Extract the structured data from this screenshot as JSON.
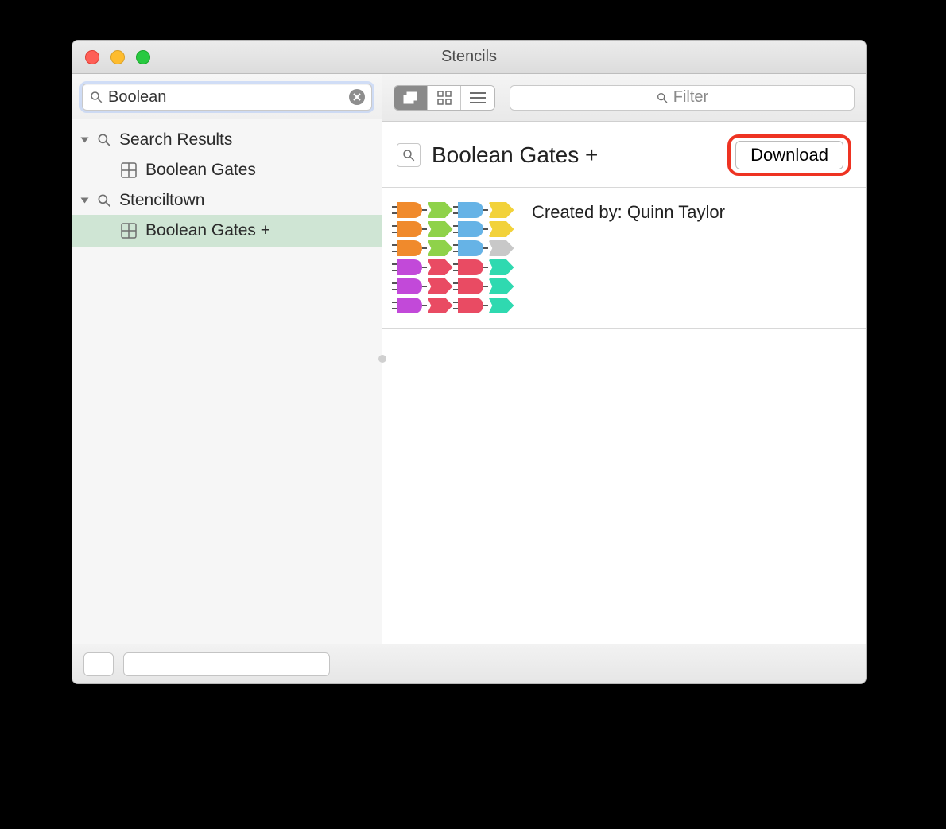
{
  "window": {
    "title": "Stencils"
  },
  "sidebar": {
    "search": {
      "value": "Boolean",
      "placeholder": ""
    },
    "groups": [
      {
        "label": "Search Results",
        "items": [
          {
            "label": "Boolean Gates",
            "selected": false
          }
        ]
      },
      {
        "label": "Stenciltown",
        "items": [
          {
            "label": "Boolean Gates +",
            "selected": true
          }
        ]
      }
    ]
  },
  "main": {
    "filter_placeholder": "Filter",
    "detail": {
      "title": "Boolean Gates +",
      "download_label": "Download",
      "meta": "Created by: Quinn Taylor",
      "thumb_rows": [
        [
          "#f08a2c",
          "#8fd24a",
          "#66b3e6",
          "#f2d23a"
        ],
        [
          "#f08a2c",
          "#8fd24a",
          "#66b3e6",
          "#f2d23a"
        ],
        [
          "#f08a2c",
          "#8fd24a",
          "#66b3e6",
          "#c8c8c8"
        ],
        [
          "#c249d9",
          "#e94b63",
          "#e94b63",
          "#2fd9b0"
        ],
        [
          "#c249d9",
          "#e94b63",
          "#e94b63",
          "#2fd9b0"
        ],
        [
          "#c249d9",
          "#e94b63",
          "#e94b63",
          "#2fd9b0"
        ]
      ]
    }
  }
}
